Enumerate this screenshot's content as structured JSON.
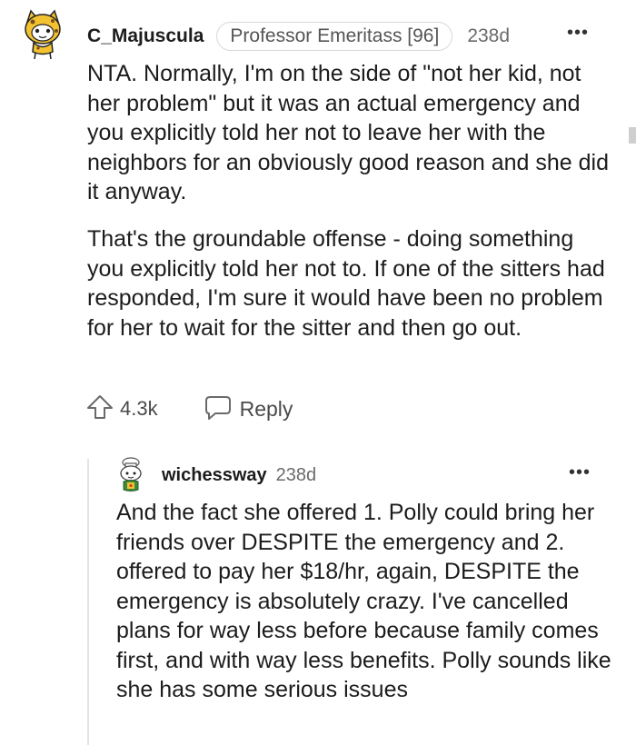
{
  "comment": {
    "username": "C_Majuscula",
    "flair": "Professor Emeritass [96]",
    "time": "238d",
    "more_label": "•••",
    "avatar_icon": "snoo-cat-avatar-icon",
    "paragraphs": [
      "NTA. Normally, I'm on the side of \"not her kid, not her problem\" but it was an actual emergency and you explicitly told her not to leave her with the neighbors for an obviously good reason and she did it anyway.",
      "That's the groundable offense - doing something you explicitly told her not to. If one of the sitters had responded, I'm sure it would have been no problem for her to wait for the sitter and then go out."
    ],
    "upvotes": "4.3k",
    "reply_label": "Reply"
  },
  "reply": {
    "username": "wichessway",
    "time": "238d",
    "more_label": "•••",
    "avatar_icon": "snoo-chef-avatar-icon",
    "text": "And the fact she offered 1. Polly could bring her friends over DESPITE the emergency and 2. offered to pay her $18/hr, again, DESPITE the emergency is absolutely crazy. I've cancelled plans for way less before because family comes first, and with way less benefits. Polly sounds like she has some serious issues"
  },
  "colors": {
    "text": "#1c1c1c",
    "meta": "#6a6a6a",
    "thread_line": "#e4e4e4",
    "avatar_yellow": "#f2c230"
  }
}
